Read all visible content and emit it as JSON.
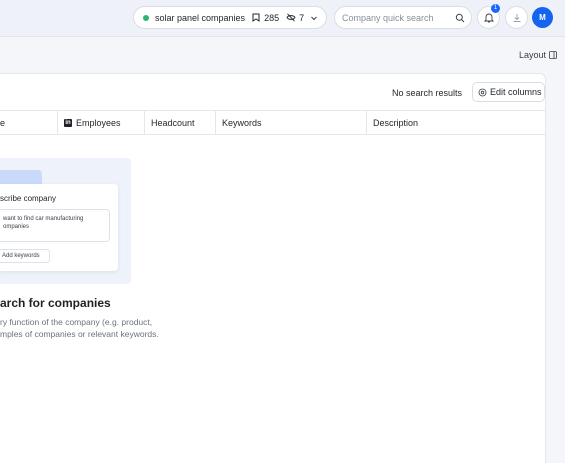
{
  "topbar": {
    "saved_search": {
      "name": "solar panel companies",
      "bookmark_count": "285",
      "excluded_count": "7",
      "status_color": "#2bb673"
    },
    "quick_search_placeholder": "Company quick search",
    "notification_count": "1",
    "avatar_initial": "M"
  },
  "layout_label": "Layout",
  "results": {
    "status_text": "No search results",
    "edit_columns_label": "Edit columns"
  },
  "table": {
    "columns": [
      "e",
      "Employees",
      "Headcount",
      "Keywords",
      "Description"
    ]
  },
  "empty_state": {
    "illustration": {
      "card_title": "scribe company",
      "input_text_line1": "want to find car manufacturing",
      "input_text_line2": "ompanies",
      "button_label": "Add keywords"
    },
    "title": "arch for companies",
    "desc_line1": "ry function of the company (e.g. product,",
    "desc_line2": "mples of companies or relevant keywords."
  },
  "colors": {
    "accent": "#1464f0",
    "background": "#f4f6f9"
  }
}
